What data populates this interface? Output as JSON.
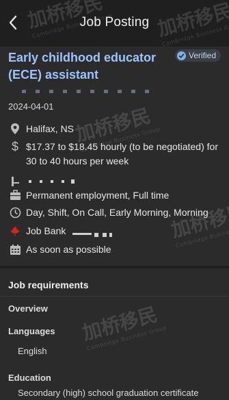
{
  "header": {
    "title": "Job Posting",
    "back_icon": "chevron-left-icon"
  },
  "job": {
    "title": "Early childhood educator (ECE) assistant",
    "verified_label": "Verified",
    "posted_date": "2024-04-01",
    "location": "Halifax, NS",
    "salary": "$17.37 to $18.45 hourly (to be negotiated) for 30 to 40 hours per week",
    "employment_type": "Permanent employment, Full time",
    "schedule": "Day, Shift, On Call, Early Morning, Morning",
    "source": "Job Bank",
    "start": "As soon as possible"
  },
  "requirements": {
    "heading": "Job requirements",
    "overview_label": "Overview",
    "languages_label": "Languages",
    "languages_value": "English",
    "education_label": "Education",
    "education_value": "Secondary (high) school graduation certificate"
  },
  "watermark": {
    "main": "加桥移民",
    "sub": "Cambridge Business Group",
    "logo": "CBG"
  },
  "colors": {
    "accent_title": "#9bc4ff",
    "background": "#1f1f1f",
    "card": "#2b2b2b",
    "verified_check": "#7fb0ea"
  }
}
